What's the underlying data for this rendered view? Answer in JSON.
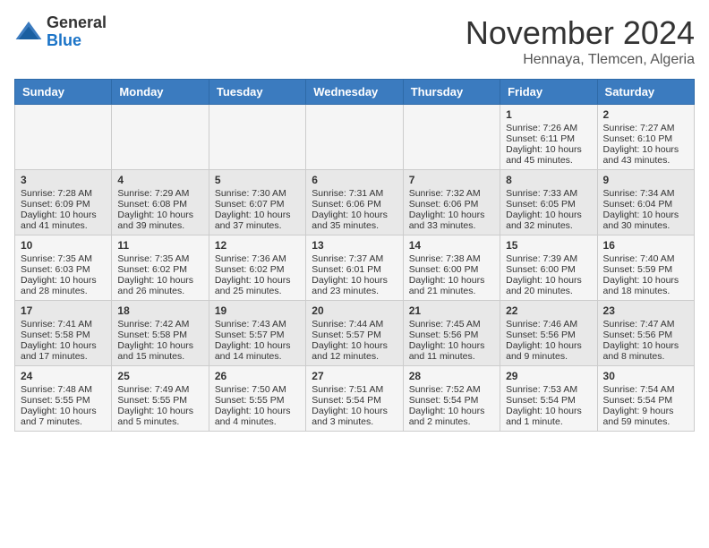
{
  "header": {
    "logo_general": "General",
    "logo_blue": "Blue",
    "title": "November 2024",
    "subtitle": "Hennaya, Tlemcen, Algeria"
  },
  "days_of_week": [
    "Sunday",
    "Monday",
    "Tuesday",
    "Wednesday",
    "Thursday",
    "Friday",
    "Saturday"
  ],
  "weeks": [
    [
      {
        "day": "",
        "info": ""
      },
      {
        "day": "",
        "info": ""
      },
      {
        "day": "",
        "info": ""
      },
      {
        "day": "",
        "info": ""
      },
      {
        "day": "",
        "info": ""
      },
      {
        "day": "1",
        "info": "Sunrise: 7:26 AM\nSunset: 6:11 PM\nDaylight: 10 hours and 45 minutes."
      },
      {
        "day": "2",
        "info": "Sunrise: 7:27 AM\nSunset: 6:10 PM\nDaylight: 10 hours and 43 minutes."
      }
    ],
    [
      {
        "day": "3",
        "info": "Sunrise: 7:28 AM\nSunset: 6:09 PM\nDaylight: 10 hours and 41 minutes."
      },
      {
        "day": "4",
        "info": "Sunrise: 7:29 AM\nSunset: 6:08 PM\nDaylight: 10 hours and 39 minutes."
      },
      {
        "day": "5",
        "info": "Sunrise: 7:30 AM\nSunset: 6:07 PM\nDaylight: 10 hours and 37 minutes."
      },
      {
        "day": "6",
        "info": "Sunrise: 7:31 AM\nSunset: 6:06 PM\nDaylight: 10 hours and 35 minutes."
      },
      {
        "day": "7",
        "info": "Sunrise: 7:32 AM\nSunset: 6:06 PM\nDaylight: 10 hours and 33 minutes."
      },
      {
        "day": "8",
        "info": "Sunrise: 7:33 AM\nSunset: 6:05 PM\nDaylight: 10 hours and 32 minutes."
      },
      {
        "day": "9",
        "info": "Sunrise: 7:34 AM\nSunset: 6:04 PM\nDaylight: 10 hours and 30 minutes."
      }
    ],
    [
      {
        "day": "10",
        "info": "Sunrise: 7:35 AM\nSunset: 6:03 PM\nDaylight: 10 hours and 28 minutes."
      },
      {
        "day": "11",
        "info": "Sunrise: 7:35 AM\nSunset: 6:02 PM\nDaylight: 10 hours and 26 minutes."
      },
      {
        "day": "12",
        "info": "Sunrise: 7:36 AM\nSunset: 6:02 PM\nDaylight: 10 hours and 25 minutes."
      },
      {
        "day": "13",
        "info": "Sunrise: 7:37 AM\nSunset: 6:01 PM\nDaylight: 10 hours and 23 minutes."
      },
      {
        "day": "14",
        "info": "Sunrise: 7:38 AM\nSunset: 6:00 PM\nDaylight: 10 hours and 21 minutes."
      },
      {
        "day": "15",
        "info": "Sunrise: 7:39 AM\nSunset: 6:00 PM\nDaylight: 10 hours and 20 minutes."
      },
      {
        "day": "16",
        "info": "Sunrise: 7:40 AM\nSunset: 5:59 PM\nDaylight: 10 hours and 18 minutes."
      }
    ],
    [
      {
        "day": "17",
        "info": "Sunrise: 7:41 AM\nSunset: 5:58 PM\nDaylight: 10 hours and 17 minutes."
      },
      {
        "day": "18",
        "info": "Sunrise: 7:42 AM\nSunset: 5:58 PM\nDaylight: 10 hours and 15 minutes."
      },
      {
        "day": "19",
        "info": "Sunrise: 7:43 AM\nSunset: 5:57 PM\nDaylight: 10 hours and 14 minutes."
      },
      {
        "day": "20",
        "info": "Sunrise: 7:44 AM\nSunset: 5:57 PM\nDaylight: 10 hours and 12 minutes."
      },
      {
        "day": "21",
        "info": "Sunrise: 7:45 AM\nSunset: 5:56 PM\nDaylight: 10 hours and 11 minutes."
      },
      {
        "day": "22",
        "info": "Sunrise: 7:46 AM\nSunset: 5:56 PM\nDaylight: 10 hours and 9 minutes."
      },
      {
        "day": "23",
        "info": "Sunrise: 7:47 AM\nSunset: 5:56 PM\nDaylight: 10 hours and 8 minutes."
      }
    ],
    [
      {
        "day": "24",
        "info": "Sunrise: 7:48 AM\nSunset: 5:55 PM\nDaylight: 10 hours and 7 minutes."
      },
      {
        "day": "25",
        "info": "Sunrise: 7:49 AM\nSunset: 5:55 PM\nDaylight: 10 hours and 5 minutes."
      },
      {
        "day": "26",
        "info": "Sunrise: 7:50 AM\nSunset: 5:55 PM\nDaylight: 10 hours and 4 minutes."
      },
      {
        "day": "27",
        "info": "Sunrise: 7:51 AM\nSunset: 5:54 PM\nDaylight: 10 hours and 3 minutes."
      },
      {
        "day": "28",
        "info": "Sunrise: 7:52 AM\nSunset: 5:54 PM\nDaylight: 10 hours and 2 minutes."
      },
      {
        "day": "29",
        "info": "Sunrise: 7:53 AM\nSunset: 5:54 PM\nDaylight: 10 hours and 1 minute."
      },
      {
        "day": "30",
        "info": "Sunrise: 7:54 AM\nSunset: 5:54 PM\nDaylight: 9 hours and 59 minutes."
      }
    ]
  ]
}
